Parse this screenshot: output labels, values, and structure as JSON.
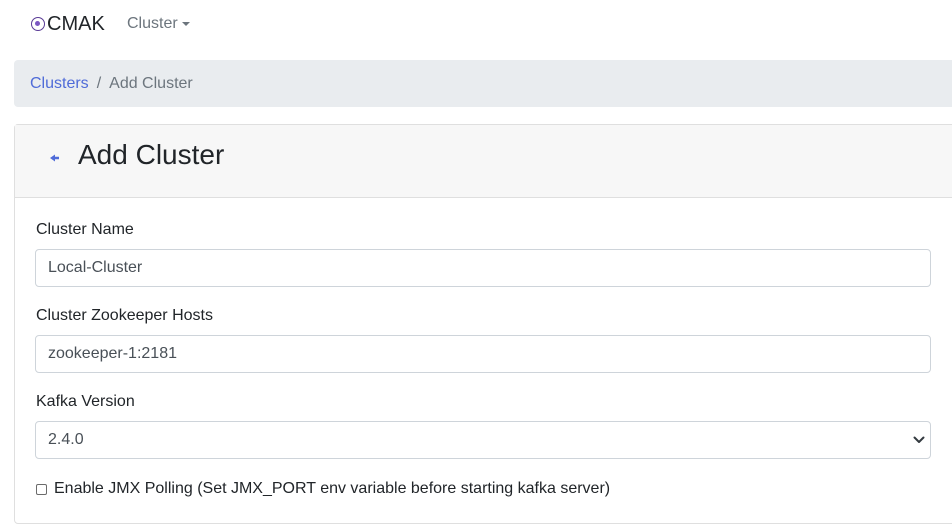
{
  "navbar": {
    "brand": "CMAK",
    "cluster_menu": "Cluster"
  },
  "breadcrumb": {
    "link": "Clusters",
    "separator": "/",
    "current": "Add Cluster"
  },
  "card": {
    "title": "Add Cluster"
  },
  "form": {
    "cluster_name_label": "Cluster Name",
    "cluster_name_value": "Local-Cluster",
    "zk_hosts_label": "Cluster Zookeeper Hosts",
    "zk_hosts_value": "zookeeper-1:2181",
    "kafka_version_label": "Kafka Version",
    "kafka_version_value": "2.4.0",
    "jmx_label": "Enable JMX Polling (Set JMX_PORT env variable before starting kafka server)",
    "jmx_checked": false
  },
  "colors": {
    "link": "#4f6bd8",
    "breadcrumb_bg": "#e9ecef",
    "card_header_bg": "#f7f7f7",
    "brand_logo": "#7b56c2"
  }
}
